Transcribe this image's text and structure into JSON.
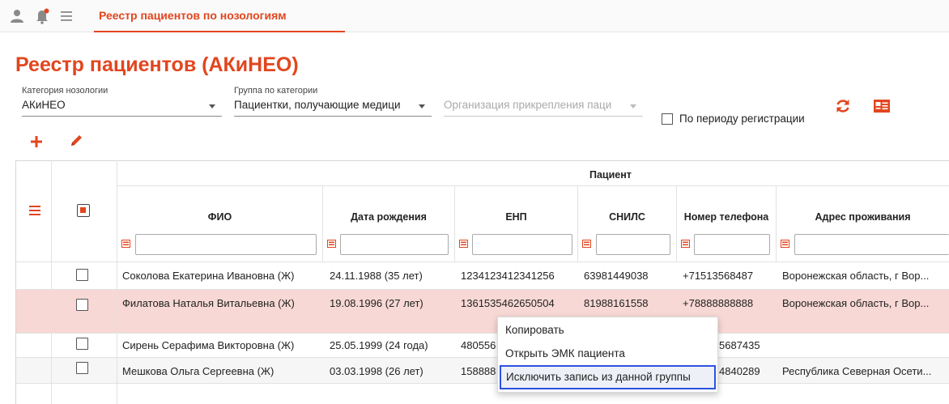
{
  "topbar": {
    "tab_title": "Реестр пациентов по нозологиям",
    "icons": [
      "user-icon",
      "bell-icon",
      "hamburger-icon"
    ]
  },
  "page": {
    "title": "Реестр пациентов (АКиНЕО)"
  },
  "filters": {
    "category": {
      "label": "Категория нозологии",
      "value": "АКиНЕО"
    },
    "group": {
      "label": "Группа по категории",
      "value": "Пациентки, получающие медици"
    },
    "organization": {
      "placeholder": "Организация прикрепления паци"
    },
    "period": {
      "label": "По периоду регистрации",
      "checked": false
    }
  },
  "toolbar": {
    "icons": [
      "refresh-icon",
      "id-card-icon",
      "add-icon",
      "edit-icon"
    ]
  },
  "table": {
    "group_header": "Пациент",
    "columns": [
      "ФИО",
      "Дата рождения",
      "ЕНП",
      "СНИЛС",
      "Номер телефона",
      "Адрес проживания"
    ],
    "rows": [
      {
        "fio": "Соколова Екатерина Ивановна (Ж)",
        "dob": "24.11.1988 (35 лет)",
        "enp": "1234123412341256",
        "snils": "63981449038",
        "phone": "+71513568487",
        "address": "Воронежская область, г Вор..."
      },
      {
        "fio": "Филатова Наталья Витальевна (Ж)",
        "dob": "19.08.1996 (27 лет)",
        "enp": "1361535462650504",
        "snils": "81988161558",
        "phone": "+78888888888",
        "address": "Воронежская область, г Вор..."
      },
      {
        "fio": "Сирень Серафима Викторовна (Ж)",
        "dob": "25.05.1999 (24 года)",
        "enp": "480556",
        "snils": "",
        "phone": "5687435",
        "address": ""
      },
      {
        "fio": "Мешкова Ольга Сергеевна (Ж)",
        "dob": "03.03.1998 (26 лет)",
        "enp": "158888",
        "snils": "",
        "phone": "4840289",
        "address": "Республика Северная Осети..."
      }
    ]
  },
  "context_menu": {
    "items": [
      "Копировать",
      "Открыть ЭМК пациента",
      "Исключить запись из данной группы"
    ],
    "selected": "Исключить запись из данной группы"
  },
  "colors": {
    "accent": "#e2461f",
    "row_highlight": "#f7d8d4",
    "selection_border": "#2c52e0"
  }
}
